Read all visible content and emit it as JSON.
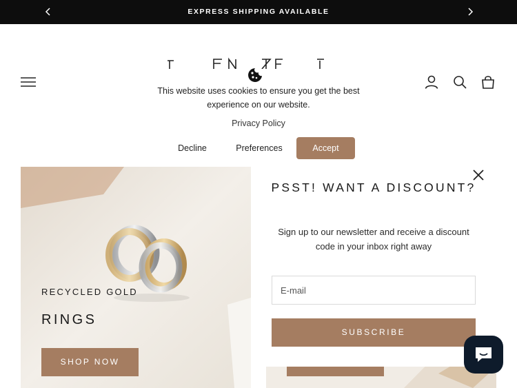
{
  "announcement": {
    "message": "EXPRESS SHIPPING AVAILABLE"
  },
  "header": {
    "icons": [
      "menu-icon",
      "account-icon",
      "search-icon",
      "cart-icon"
    ]
  },
  "cookie_banner": {
    "text": "This website uses cookies to ensure you get the best experience on our website.",
    "privacy_policy": "Privacy Policy",
    "decline": "Decline",
    "preferences": "Preferences",
    "accept": "Accept"
  },
  "hero": {
    "eyebrow": "RECYCLED GOLD",
    "title": "RINGS",
    "cta": "SHOP NOW"
  },
  "popup": {
    "heading": "PSST! WANT A DISCOUNT?",
    "description": "Sign up to our newsletter and receive a discount code in your inbox right away",
    "email_placeholder": "E-mail",
    "subscribe": "SUBSCRIBE"
  },
  "colors": {
    "accent": "#a57d61",
    "announcement_bg": "#0d0d0d",
    "chat_bg": "#0e1b2b"
  }
}
